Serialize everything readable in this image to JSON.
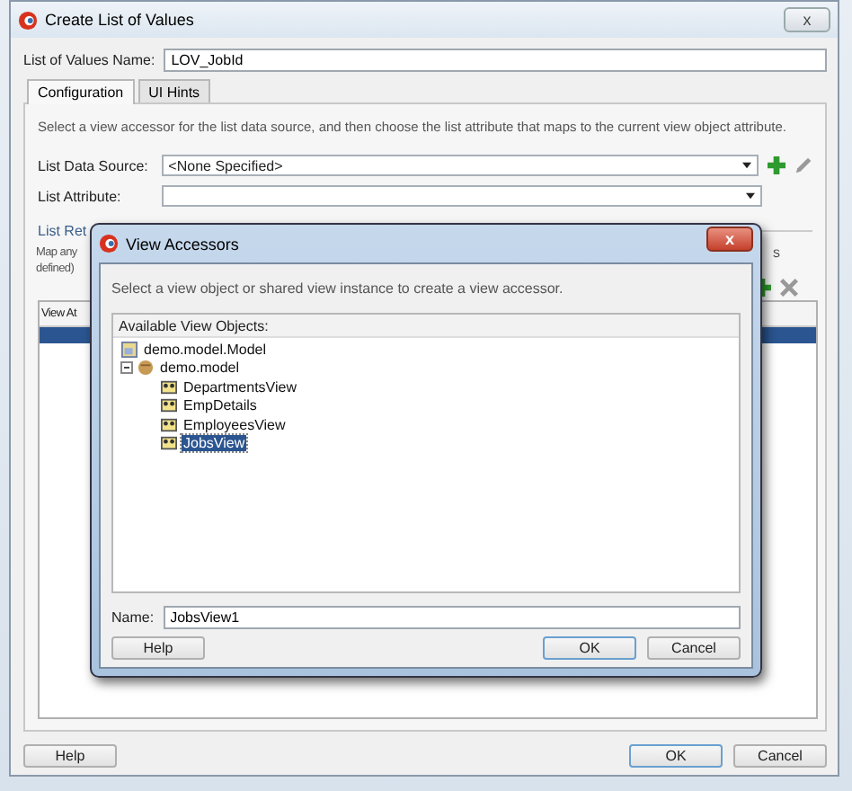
{
  "window": {
    "title": "Create List of Values",
    "close": "x"
  },
  "lov_name": {
    "label": "List of Values Name:",
    "value": "LOV_JobId"
  },
  "tabs": [
    {
      "label": "Configuration",
      "selected": true
    },
    {
      "label": "UI Hints",
      "selected": false
    }
  ],
  "description": "Select a view accessor for the list data source, and then choose the list attribute that maps to the current view object attribute.",
  "fields": [
    {
      "label": "List Data Source:",
      "value": "<None Specified>"
    },
    {
      "label": "List Attribute:"
    }
  ],
  "list_return": {
    "heading": "List Ret",
    "text_lines": [
      "Map any",
      "defined)"
    ],
    "tail": "s",
    "table": {
      "columns": [
        "View At"
      ],
      "rows": [
        {
          "selected": true
        }
      ]
    }
  },
  "buttons": [
    "Help",
    "OK",
    "Cancel"
  ],
  "dialog": {
    "title": "View Accessors",
    "close": "x",
    "instruction": "Select a view object or shared view instance to create a view accessor.",
    "tree": {
      "heading": "Available View Objects:",
      "items": [
        {
          "label": "demo.model.Model",
          "kind": "project",
          "selected": false
        },
        {
          "label": "demo.model",
          "kind": "package",
          "selected": false,
          "children": [
            {
              "label": "DepartmentsView",
              "kind": "view",
              "selected": false
            },
            {
              "label": "EmpDetails",
              "kind": "view",
              "selected": false
            },
            {
              "label": "EmployeesView",
              "kind": "view",
              "selected": false
            },
            {
              "label": "JobsView",
              "kind": "view",
              "selected": true
            }
          ]
        }
      ]
    },
    "name": {
      "label": "Name:",
      "value": "JobsView1"
    },
    "buttons": [
      "Help",
      "OK",
      "Cancel"
    ]
  }
}
